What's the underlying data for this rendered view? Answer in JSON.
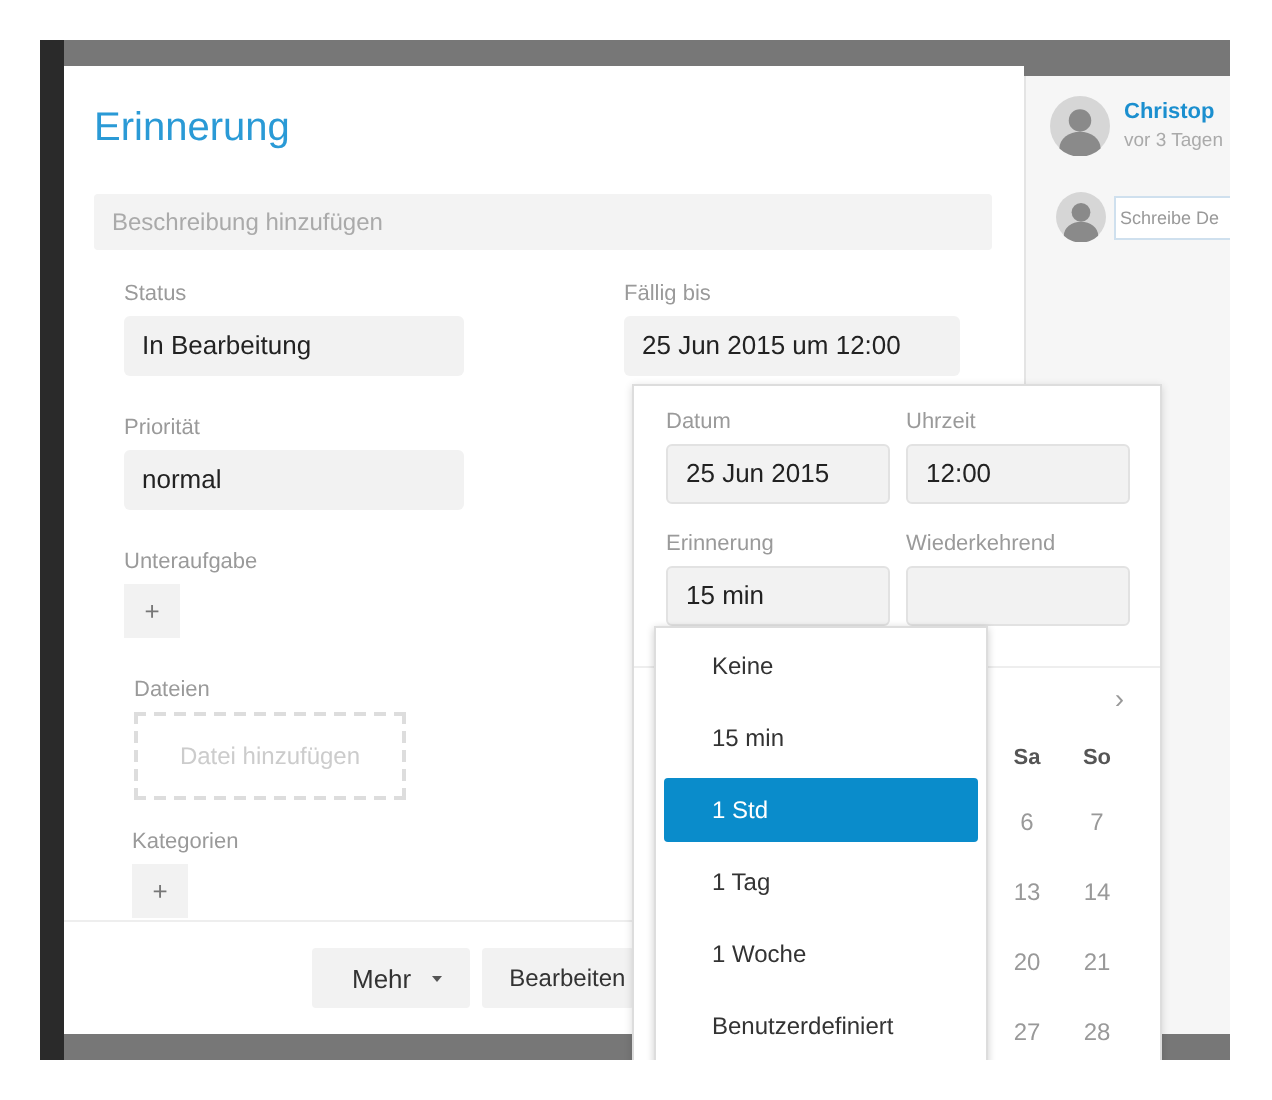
{
  "dialog": {
    "title": "Erinnerung",
    "description": {
      "placeholder": "Beschreibung hinzufügen"
    },
    "fields": [
      {
        "label": "Status",
        "value": "In Bearbeitung"
      },
      {
        "label": "Priorität",
        "value": "normal"
      }
    ],
    "due": {
      "label": "Fällig bis",
      "value": "25 Jun 2015 um 12:00"
    },
    "subtask": {
      "label": "Unteraufgabe",
      "button": "+"
    },
    "files": {
      "label": "Dateien",
      "drop": "Datei hinzufügen"
    },
    "categories": {
      "label": "Kategorien",
      "button": "+"
    },
    "buttons": [
      {
        "label": "Mehr",
        "kind": "dropdown"
      },
      {
        "label": "Bearbeiten",
        "kind": "plain"
      }
    ]
  },
  "activity": {
    "author": "Christop",
    "time": "vor 3 Tagen",
    "comment": {
      "placeholder": "Schreibe De"
    }
  },
  "picker": {
    "fields": [
      {
        "label": "Datum",
        "value": "25 Jun 2015"
      },
      {
        "label": "Uhrzeit",
        "value": "12:00"
      },
      {
        "label": "Erinnerung",
        "value": "15 min"
      },
      {
        "label": "Wiederkehrend"
      }
    ],
    "calendar": {
      "next": "›",
      "weekdays": [
        "Sa",
        "So"
      ],
      "weeks": [
        [
          "6",
          "7"
        ],
        [
          "13",
          "14"
        ],
        [
          "20",
          "21"
        ],
        [
          "27",
          "28"
        ]
      ]
    },
    "reminder_options": [
      {
        "label": "Keine",
        "selected": false
      },
      {
        "label": "15 min",
        "selected": false
      },
      {
        "label": "1 Std",
        "selected": true
      },
      {
        "label": "1 Tag",
        "selected": false
      },
      {
        "label": "1 Woche",
        "selected": false
      },
      {
        "label": "Benutzerdefiniert",
        "selected": false
      }
    ]
  }
}
